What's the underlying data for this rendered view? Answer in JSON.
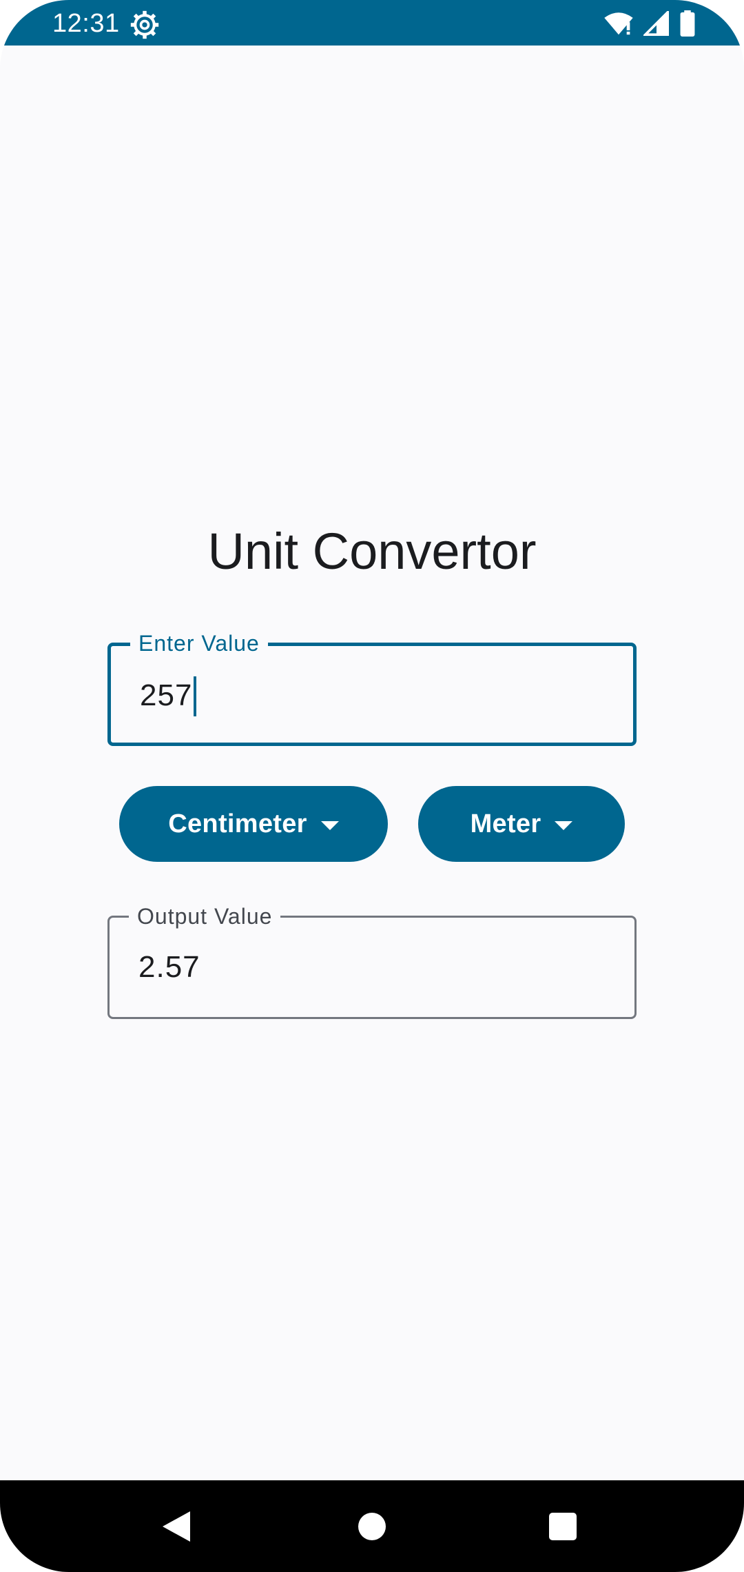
{
  "status_bar": {
    "time": "12:31",
    "icons": [
      "settings-gear-icon",
      "wifi-icon",
      "signal-icon",
      "battery-icon"
    ]
  },
  "app": {
    "title": "Unit Convertor"
  },
  "input_field": {
    "label": "Enter Value",
    "value": "257"
  },
  "from_unit": {
    "label": "Centimeter"
  },
  "to_unit": {
    "label": "Meter"
  },
  "output_field": {
    "label": "Output Value",
    "value": "2.57"
  },
  "nav_bar": {
    "icons": [
      "back-icon",
      "home-icon",
      "recents-icon"
    ]
  },
  "colors": {
    "primary": "#00668f",
    "background": "#fafafc",
    "text": "#1b1c1f",
    "outline": "#73777f"
  }
}
